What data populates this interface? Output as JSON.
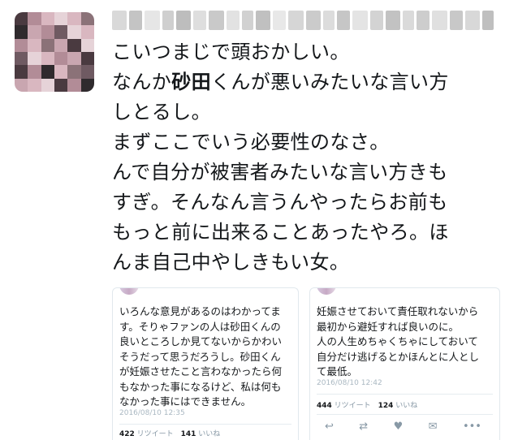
{
  "tweet": {
    "author_blurred": "",
    "lines": [
      {
        "pre": "こいつまじで頭おかしい。",
        "bold": "",
        "post": ""
      },
      {
        "pre": "なんか",
        "bold": "砂田",
        "post": "くんが悪いみたいな言い方"
      },
      {
        "pre": "しとるし。",
        "bold": "",
        "post": ""
      },
      {
        "pre": "まずここでいう必要性のなさ。",
        "bold": "",
        "post": ""
      },
      {
        "pre": "んで自分が被害者みたいな言い方きも",
        "bold": "",
        "post": ""
      },
      {
        "pre": "すぎ。そんなん言うんやったらお前も",
        "bold": "",
        "post": ""
      },
      {
        "pre": "もっと前に出来ることあったやろ。ほ",
        "bold": "",
        "post": ""
      },
      {
        "pre": "んま自己中やしきもい女。",
        "bold": "",
        "post": ""
      }
    ]
  },
  "quoted_left": {
    "lines": [
      "いろんな意見があるのはわかってま",
      "す。そりゃファンの人は砂田くんの",
      "良いところしか見てないからかわい",
      "そうだって思うだろうし。砂田くん",
      "が妊娠させたこと言わなかったら何",
      "もなかった事になるけど、私は何も",
      "なかった事にはできません。"
    ],
    "date": "2016/08/10 12:35",
    "retweets": "422",
    "retweets_label": "リツイート",
    "likes": "141",
    "likes_label": "いいね"
  },
  "quoted_right": {
    "lines": [
      "妊娠させておいて責任取れないから",
      "最初から避妊すれば良いのに。",
      "人の人生めちゃくちゃにしておいて",
      "自分だけ逃げるとかほんとに人とし",
      "て最低。"
    ],
    "date": "2016/08/10 12:42",
    "retweets": "444",
    "retweets_label": "リツイート",
    "likes": "124",
    "likes_label": "いいね",
    "actions": [
      {
        "icon": "reply-icon",
        "glyph": "↩"
      },
      {
        "icon": "retweet-icon",
        "glyph": "⇄"
      },
      {
        "icon": "like-icon",
        "glyph": "♥"
      },
      {
        "icon": "message-icon",
        "glyph": "✉"
      },
      {
        "icon": "more-icon",
        "glyph": "•••"
      }
    ]
  },
  "colors": {
    "text": "#14171a",
    "muted": "#8899a6",
    "border": "#e1e8ed",
    "avatar_palette": [
      "#6f5a62",
      "#b28c97",
      "#d9b7c0",
      "#4a3a40",
      "#e6d3d8",
      "#8b7278",
      "#c9a6b0",
      "#2f2a2d"
    ]
  }
}
